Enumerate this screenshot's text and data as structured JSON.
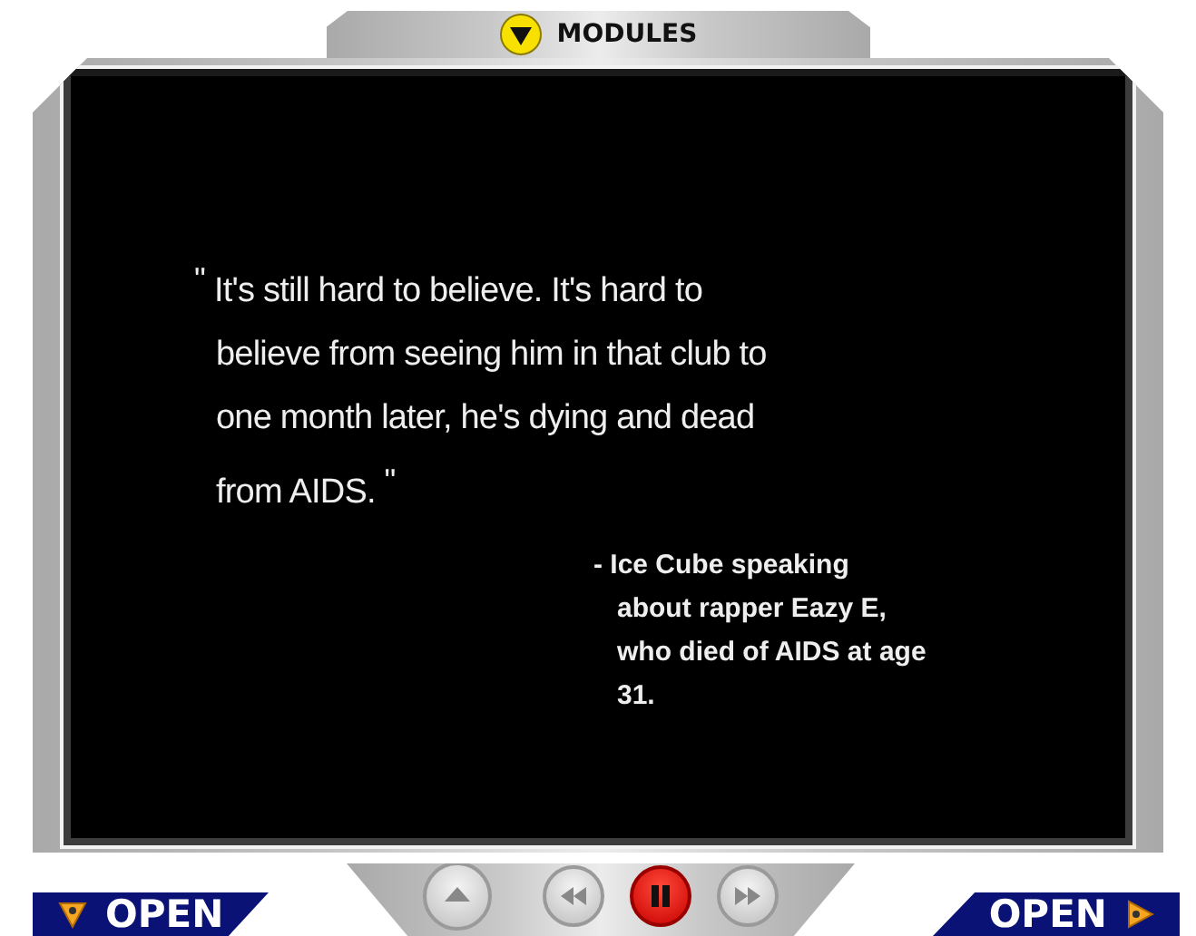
{
  "header": {
    "label": "MODULES"
  },
  "quote": {
    "open_mark": "\"",
    "text": "It's still hard to believe. It's hard to believe from seeing him in that club to one month later, he's dying and dead from AIDS.",
    "close_mark": "\"",
    "attribution": "- Ice Cube speaking about rapper Eazy E, who died of AIDS at age 31."
  },
  "open_buttons": [
    {
      "label": "OPEN"
    },
    {
      "label": "OPEN"
    }
  ],
  "controls": [
    {
      "kind": "eject",
      "active": false
    },
    {
      "kind": "rewind",
      "active": false
    },
    {
      "kind": "pause",
      "active": true
    },
    {
      "kind": "forward",
      "active": false
    }
  ]
}
